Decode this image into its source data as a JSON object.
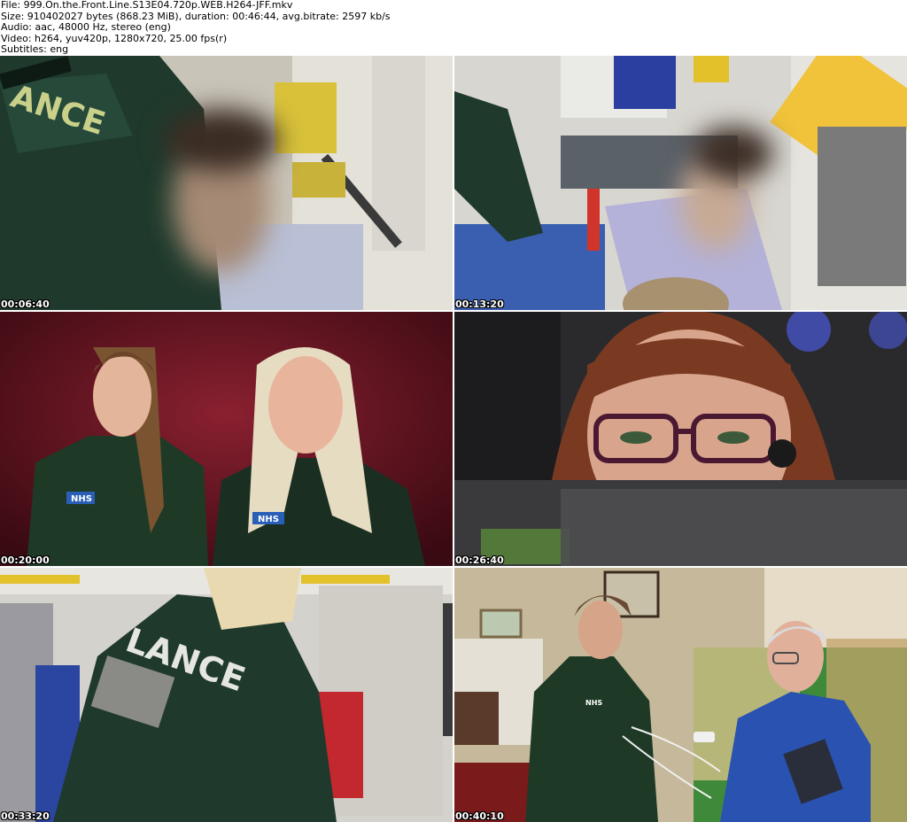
{
  "header": {
    "file": "File: 999.On.the.Front.Line.S13E04.720p.WEB.H264-JFF.mkv",
    "size": "Size: 910402027 bytes (868.23 MiB), duration: 00:46:44, avg.bitrate: 2597 kb/s",
    "audio": "Audio: aac, 48000 Hz, stereo (eng)",
    "video": "Video: h264, yuv420p, 1280x720, 25.00 fps(r)",
    "subtitles": "Subtitles: eng"
  },
  "thumbnails": [
    {
      "timestamp": "00:06:40",
      "text": "ANCE"
    },
    {
      "timestamp": "00:13:20"
    },
    {
      "timestamp": "00:20:00",
      "text_left": "NHS",
      "text_right": "NHS"
    },
    {
      "timestamp": "00:26:40"
    },
    {
      "timestamp": "00:33:20",
      "text": "LANCE"
    },
    {
      "timestamp": "00:40:10",
      "text": "NHS"
    }
  ]
}
